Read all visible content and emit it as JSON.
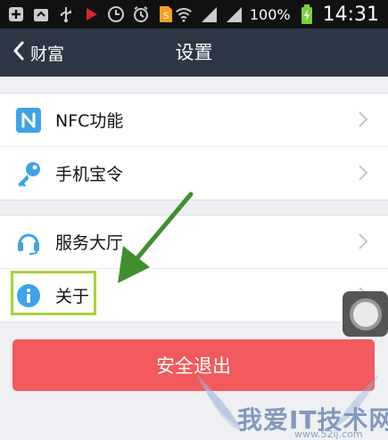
{
  "status_bar": {
    "battery_percent": "100%",
    "time": "14:31"
  },
  "nav": {
    "back_label": "财富",
    "title": "设置"
  },
  "groups": [
    {
      "items": [
        {
          "label": "NFC功能",
          "icon": "nfc-icon"
        },
        {
          "label": "手机宝令",
          "icon": "key-icon"
        }
      ]
    },
    {
      "items": [
        {
          "label": "服务大厅",
          "icon": "headset-icon"
        },
        {
          "label": "关于",
          "icon": "info-icon"
        }
      ]
    }
  ],
  "logout_label": "安全退出",
  "watermark": {
    "text": "我爱IT技术网",
    "url": "www.52ij.com"
  },
  "colors": {
    "nav_bg": "#2d3644",
    "icon_blue": "#3fa2e6",
    "logout_red": "#f25a5d",
    "highlight_green": "#a8d13a",
    "arrow_green": "#3f8f2f"
  }
}
